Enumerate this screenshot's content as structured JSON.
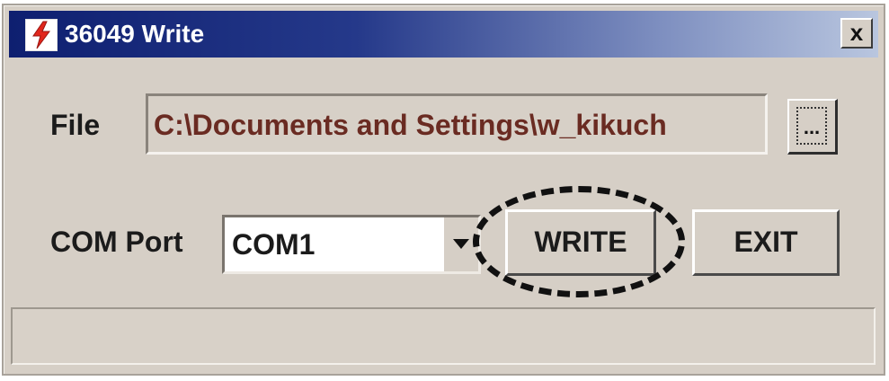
{
  "window": {
    "title": "36049 Write",
    "close_label": "x",
    "title_gradient": [
      "#0e1f70",
      "#b9c6df"
    ],
    "app_icon": "lightning-app-icon"
  },
  "file": {
    "label": "File",
    "path": "C:\\Documents and Settings\\w_kikuch",
    "browse_label": "...",
    "browse_icon": "ellipsis-icon"
  },
  "com": {
    "label": "COM Port",
    "selected": "COM1",
    "dropdown_icon": "chevron-down-icon"
  },
  "actions": {
    "write_label": "WRITE",
    "exit_label": "EXIT"
  },
  "colors": {
    "window_bg": "#d6cfc6",
    "path_text": "#6a2b22",
    "icon_red": "#e1261c"
  }
}
